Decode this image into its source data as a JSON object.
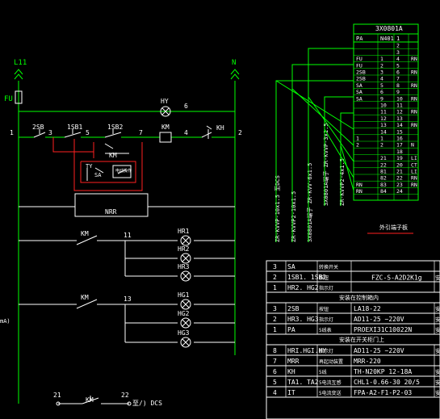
{
  "rails": {
    "left": "L11",
    "right": "N",
    "fuse": "FU",
    "rung1_left": "1",
    "rung1_right": "2"
  },
  "top_rung": {
    "sb2": "2SB",
    "sb1": "1SB1",
    "sb2b": "1SB2",
    "n3": "3",
    "n5": "5",
    "n7": "7",
    "n4": "4",
    "n6": "6",
    "hy": "HY",
    "km_coil": "KM",
    "kh": "KH"
  },
  "relay_box": {
    "km": "KM",
    "ty": "TY",
    "sa": "SA",
    "label": "电动操作",
    "nrr": "NRR"
  },
  "lamp_rungs": {
    "km1": "KM",
    "km2": "KM",
    "n11": "11",
    "n13": "13",
    "lamps": [
      "HR1",
      "HR2",
      "HR3",
      "HG1",
      "HG2",
      "HG3"
    ]
  },
  "bottom": {
    "n21": "21",
    "n22": "22",
    "km": "KM",
    "dcs": "至/) DCS",
    "ma": "mA)"
  },
  "cables": [
    "ZR-KVVP-10x1.5 至DCS",
    "ZR-KVVP2-10x1.5",
    "3X0801A端子 ZR-KVV-6x1.5",
    "3X0801A端子 ZR-KVVP-3x1.5",
    "ZR-KVVP2-4x1.5"
  ],
  "terminal": {
    "title": "3X0801A",
    "header": [
      "PA",
      "N401",
      "1"
    ],
    "rows": [
      [
        "",
        "",
        "2",
        ""
      ],
      [
        "",
        "",
        "3",
        ""
      ],
      [
        "FU",
        "1",
        "4",
        "RN"
      ],
      [
        "FU",
        "2",
        "5",
        ""
      ],
      [
        "2SB",
        "3",
        "6",
        "RN"
      ],
      [
        "2SB",
        "4",
        "7",
        ""
      ],
      [
        "SA",
        "5",
        "8",
        "RN"
      ],
      [
        "SA",
        "6",
        "9",
        ""
      ],
      [
        "SA",
        "9",
        "10",
        "RN"
      ],
      [
        "",
        "10",
        "11",
        ""
      ],
      [
        "",
        "11",
        "12",
        "RN"
      ],
      [
        "",
        "12",
        "13",
        ""
      ],
      [
        "",
        "13",
        "14",
        "RN"
      ],
      [
        "",
        "14",
        "15",
        ""
      ],
      [
        "1",
        "1",
        "16",
        ""
      ],
      [
        "2",
        "2",
        "17",
        "N"
      ],
      [
        "",
        "",
        "18",
        ""
      ],
      [
        "",
        "21",
        "19",
        "LI"
      ],
      [
        "",
        "22",
        "20",
        "CT"
      ],
      [
        "",
        "81",
        "21",
        "LI"
      ],
      [
        "",
        "82",
        "22",
        "RN"
      ],
      [
        "RN",
        "83",
        "23",
        "RN"
      ],
      [
        "RN",
        "84",
        "24",
        ""
      ]
    ],
    "caption": "外引端子板"
  },
  "parts": {
    "sections": [
      {
        "rows": [
          [
            "3",
            "SA",
            "转换开关"
          ],
          [
            "2",
            "1SB1. 1SB2",
            "按钮"
          ],
          [
            "1",
            "HR2. HG2",
            "指示灯"
          ]
        ],
        "model": "FZC-S-A2D2K1g",
        "tail": "安"
      },
      {
        "heading": "安装在控制箱内"
      },
      {
        "rows": [
          [
            "3",
            "2SB",
            "按钮",
            "LA18-22",
            "安"
          ],
          [
            "2",
            "HR3. HG3",
            "指示灯",
            "AD11-25    ~220V",
            "安"
          ],
          [
            "1",
            "PA",
            "5线表",
            "PROEXI31C10022N",
            "安"
          ]
        ]
      },
      {
        "heading": "安装在开关柜门上"
      },
      {
        "rows": [
          [
            "8",
            "HRI.HGI.HY",
            "指示灯",
            "AD11-25    ~220V",
            "安"
          ],
          [
            "7",
            "MRR",
            "再起动装置",
            "MRR-220",
            ""
          ],
          [
            "6",
            "KH",
            "5线",
            "TH-N20KP 12-18A",
            "安"
          ],
          [
            "5",
            "TA1. TA2",
            "5电流互感",
            "CHL1-0.66-30  20/5",
            "安"
          ],
          [
            "4",
            "IT",
            "5电流变送",
            "FPA-A2-F1-P2-03",
            "安"
          ]
        ]
      }
    ]
  }
}
